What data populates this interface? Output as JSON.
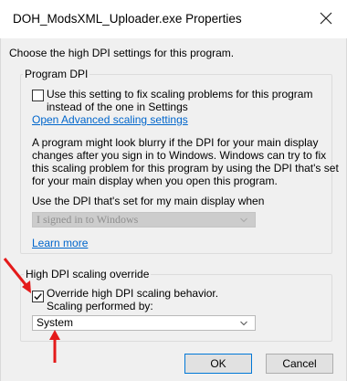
{
  "window": {
    "title": "DOH_ModsXML_Uploader.exe Properties",
    "close_icon": "close-icon"
  },
  "intro": "Choose the high DPI settings for this program.",
  "program_dpi": {
    "legend": "Program DPI",
    "checkbox_checked": false,
    "checkbox_label_line1": "Use this setting to fix scaling problems for this program",
    "checkbox_label_line2": "instead of the one in Settings",
    "link_advanced": "Open Advanced scaling settings",
    "description": [
      "A program might look blurry if the DPI for your main display",
      "changes after you sign in to Windows. Windows can try to fix",
      "this scaling problem for this program by using the DPI that's set",
      "for your main display when you open this program."
    ],
    "use_dpi_label": "Use the DPI that's set for my main display when",
    "dropdown_value": "I signed in to Windows",
    "learn_more": "Learn more"
  },
  "override": {
    "legend": "High DPI scaling override",
    "checkbox_checked": true,
    "checkbox_label_line1": "Override high DPI scaling behavior.",
    "checkbox_label_line2": "Scaling performed by:",
    "dropdown_value": "System"
  },
  "buttons": {
    "ok": "OK",
    "cancel": "Cancel"
  },
  "colors": {
    "annotation_arrow": "#e41a1a",
    "link": "#0066cc",
    "accent_border": "#0078d7"
  }
}
